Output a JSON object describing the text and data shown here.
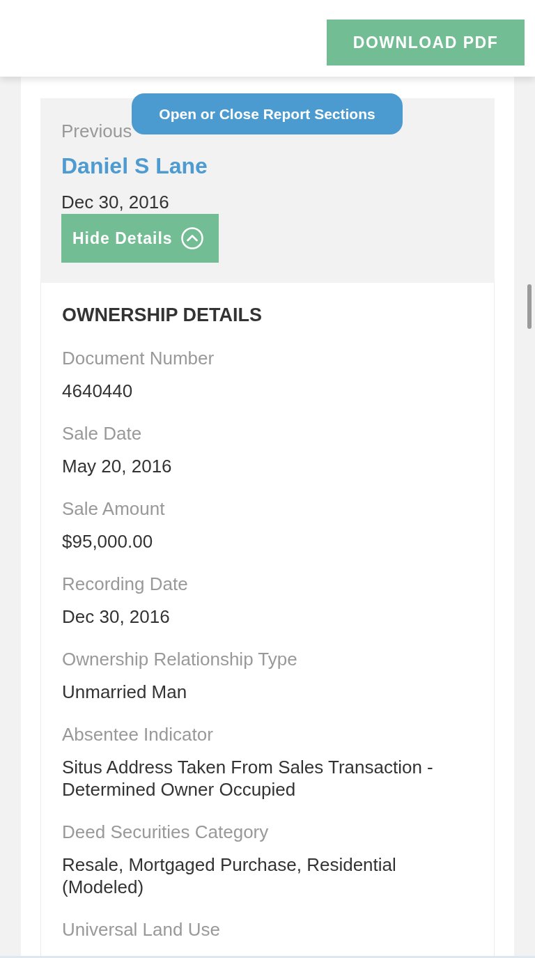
{
  "header": {
    "download_button": "DOWNLOAD PDF"
  },
  "overlay_hint": "Open or Close Report Sections",
  "owner_summary": {
    "label": "Previous",
    "name": "Daniel S Lane",
    "date": "Dec 30, 2016",
    "toggle": {
      "label": "Hide Details",
      "expanded": true
    }
  },
  "details": {
    "title": "OWNERSHIP DETAILS",
    "fields": [
      {
        "label": "Document Number",
        "value": "4640440"
      },
      {
        "label": "Sale Date",
        "value": "May 20, 2016"
      },
      {
        "label": "Sale Amount",
        "value": "$95,000.00"
      },
      {
        "label": "Recording Date",
        "value": "Dec 30, 2016"
      },
      {
        "label": "Ownership Relationship Type",
        "value": "Unmarried Man"
      },
      {
        "label": "Absentee Indicator",
        "value": "Situs Address Taken From Sales Transaction - Determined Owner Occupied"
      },
      {
        "label": "Deed Securities Category",
        "value": "Resale, Mortgaged Purchase, Residential (Modeled)"
      },
      {
        "label": "Universal Land Use"
      }
    ]
  }
}
